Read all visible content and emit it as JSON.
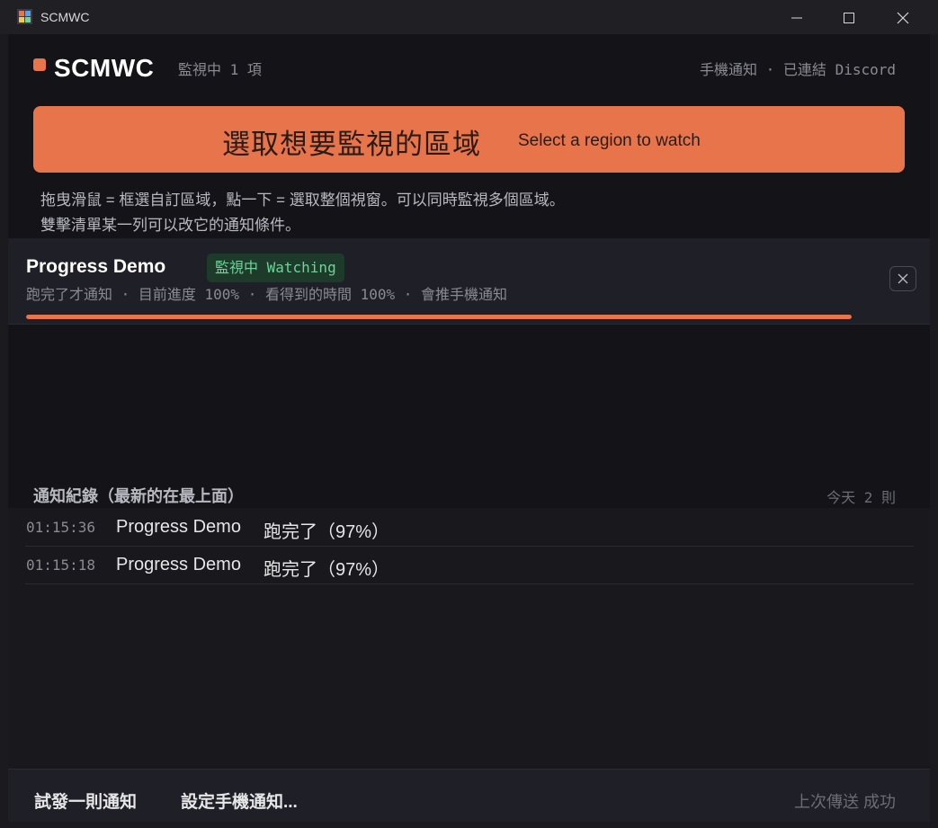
{
  "window": {
    "title": "SCMWC",
    "icon": "app-icon"
  },
  "header": {
    "brand": "SCMWC",
    "monitor_count": "監視中 1 項",
    "connection_status": "手機通知 · 已連結 Discord"
  },
  "select_region": {
    "label_zh": "選取想要監視的區域",
    "label_en": "Select a region to watch"
  },
  "hints": {
    "line1": "拖曳滑鼠 = 框選自訂區域，點一下 = 選取整個視窗。可以同時監視多個區域。",
    "line2": "雙擊清單某一列可以改它的通知條件。"
  },
  "watches": [
    {
      "name": "Progress Demo",
      "badge": "監視中 Watching",
      "detail": "跑完了才通知 · 目前進度 100% · 看得到的時間 100% · 會推手機通知",
      "progress_percent": 100
    }
  ],
  "log": {
    "title": "通知紀錄（最新的在最上面）",
    "count": "今天 2 則",
    "entries": [
      {
        "time": "01:15:36",
        "name": "Progress Demo",
        "message": "跑完了（97%）"
      },
      {
        "time": "01:15:18",
        "name": "Progress Demo",
        "message": "跑完了（97%）"
      }
    ]
  },
  "footer": {
    "test_button": "試發一則通知",
    "setup_button": "設定手機通知...",
    "last_send_status": "上次傳送 成功"
  },
  "colors": {
    "accent": "#e8744c",
    "watching_badge_bg": "#1e3a2b",
    "watching_badge_text": "#6fd39a",
    "background": "#141418"
  }
}
